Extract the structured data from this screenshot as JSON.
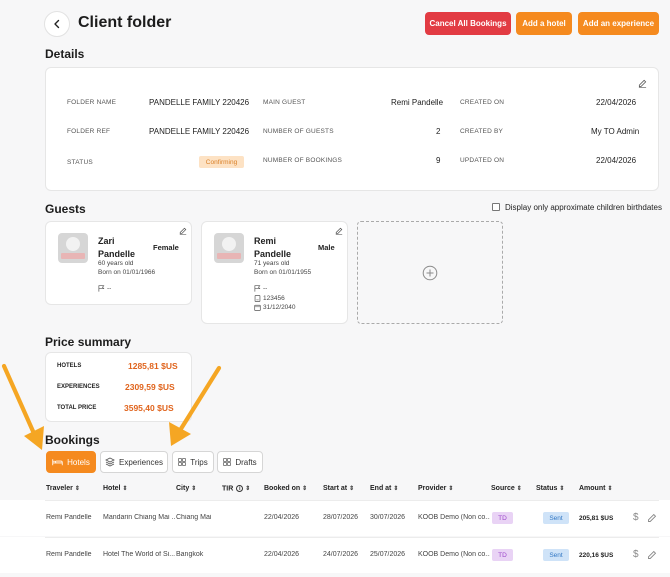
{
  "header": {
    "title": "Client folder",
    "cancel_label": "Cancel All Bookings",
    "add_hotel_label": "Add a hotel",
    "add_experience_label": "Add an experience"
  },
  "details": {
    "title": "Details",
    "folder_name_label": "FOLDER NAME",
    "folder_name": "PANDELLE FAMILY 220426",
    "folder_ref_label": "FOLDER REF",
    "folder_ref": "PANDELLE FAMILY 220426",
    "status_label": "STATUS",
    "status": "Confirming",
    "main_guest_label": "MAIN GUEST",
    "main_guest": "Remi Pandelle",
    "num_guests_label": "NUMBER OF GUESTS",
    "num_guests": "2",
    "num_bookings_label": "NUMBER OF BOOKINGS",
    "num_bookings": "9",
    "created_on_label": "CREATED ON",
    "created_on": "22/04/2026",
    "created_by_label": "CREATED BY",
    "created_by": "My TO Admin",
    "updated_on_label": "UPDATED ON",
    "updated_on": "22/04/2026"
  },
  "guests": {
    "title": "Guests",
    "approx_label": "Display only approximate children birthdates",
    "items": [
      {
        "first": "Zari",
        "last": "Pandelle",
        "gender": "Female",
        "age": "60 years old",
        "born": "Born on 01/01/1966",
        "nationality": "--"
      },
      {
        "first": "Remi",
        "last": "Pandelle",
        "gender": "Male",
        "age": "71 years old",
        "born": "Born on 01/01/1955",
        "nationality": "--",
        "passport": "123456",
        "expiry": "31/12/2040"
      }
    ]
  },
  "price": {
    "title": "Price summary",
    "hotels_label": "HOTELS",
    "hotels": "1285,81 $US",
    "experiences_label": "EXPERIENCES",
    "experiences": "2309,59 $US",
    "total_label": "TOTAL PRICE",
    "total": "3595,40 $US"
  },
  "bookings": {
    "title": "Bookings",
    "tabs": [
      {
        "label": "Hotels"
      },
      {
        "label": "Experiences"
      },
      {
        "label": "Trips"
      },
      {
        "label": "Drafts"
      }
    ],
    "columns": [
      "Traveler",
      "Hotel",
      "City",
      "TIR",
      "Booked on",
      "Start at",
      "End at",
      "Provider",
      "Source",
      "Status",
      "Amount"
    ],
    "rows": [
      {
        "traveler": "Remi Pandelle",
        "hotel": "Mandarin Chiang Mai ...",
        "city": "Chiang Mai",
        "booked": "22/04/2026",
        "start": "28/07/2026",
        "end": "30/07/2026",
        "provider": "KOOB Demo (Non co...",
        "source": "TD",
        "status": "Sent",
        "amount": "205,81 $US"
      },
      {
        "traveler": "Remi Pandelle",
        "hotel": "Hotel The World of Si...",
        "city": "Bangkok",
        "booked": "22/04/2026",
        "start": "24/07/2026",
        "end": "25/07/2026",
        "provider": "KOOB Demo (Non co...",
        "source": "TD",
        "status": "Sent",
        "amount": "220,16 $US"
      }
    ]
  },
  "colors": {
    "accent_orange": "#f58a1f",
    "danger_red": "#e23b43",
    "price_orange": "#e0641d",
    "arrow": "#f5a623"
  }
}
